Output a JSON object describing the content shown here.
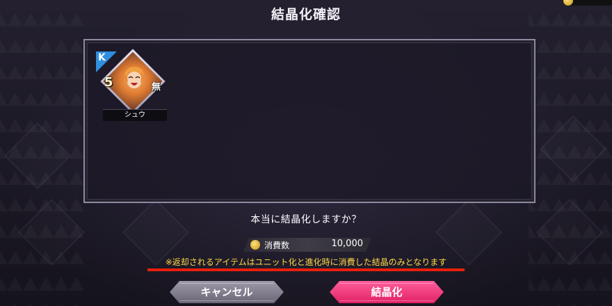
{
  "dialog": {
    "title": "結晶化確認",
    "question": "本当に結晶化しますか？",
    "cost_label": "消費数",
    "cost_value": "10,000",
    "warning": "※返却されるアイテムはユニット化と進化時に消費した結晶のみとなります"
  },
  "unit": {
    "name": "シュウ",
    "type_badge": "K",
    "rarity": "5",
    "element": "無"
  },
  "buttons": {
    "cancel": "キャンセル",
    "confirm": "結晶化"
  },
  "colors": {
    "accent_pink": "#e12165",
    "warning_yellow": "#ffd94a",
    "underline_red": "#e8200c",
    "type_blue": "#2f8ee0"
  },
  "icons": {
    "currency": "gold-coin-icon"
  }
}
